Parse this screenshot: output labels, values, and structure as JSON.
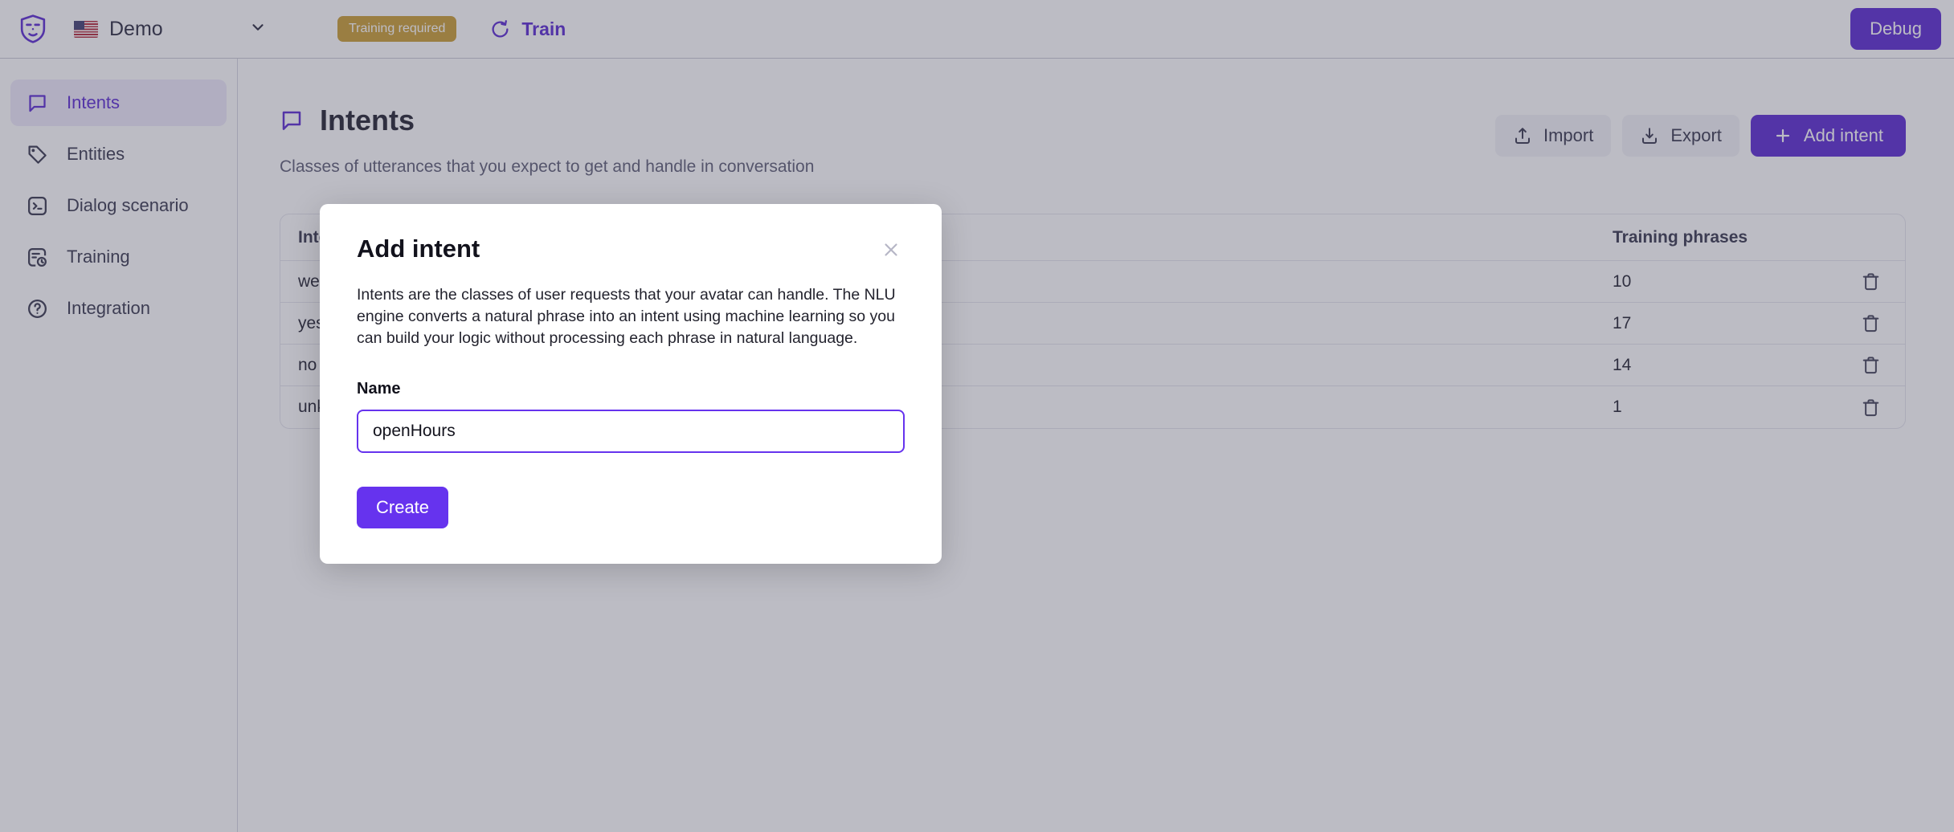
{
  "topbar": {
    "logo_icon": "shield-mask-logo",
    "bot": {
      "flag_icon": "us-flag-icon",
      "name": "Demo",
      "chevron_icon": "chevron-down-icon"
    },
    "status_badge": "Training required",
    "train_icon": "refresh-icon",
    "train_label": "Train",
    "debug_label": "Debug"
  },
  "sidebar": {
    "items": [
      {
        "label": "Intents",
        "icon": "speech-bubble-icon",
        "active": true
      },
      {
        "label": "Entities",
        "icon": "tag-icon",
        "active": false
      },
      {
        "label": "Dialog scenario",
        "icon": "terminal-icon",
        "active": false
      },
      {
        "label": "Training",
        "icon": "history-clock-icon",
        "active": false
      },
      {
        "label": "Integration",
        "icon": "question-mark-circle-icon",
        "active": false
      }
    ]
  },
  "main": {
    "title_icon": "speech-bubble-icon",
    "title": "Intents",
    "subtitle": "Classes of utterances that you expect to get and handle in conversation",
    "actions": {
      "import_icon": "upload-icon",
      "import_label": "Import",
      "export_icon": "download-icon",
      "export_label": "Export",
      "add_icon": "plus-icon",
      "add_label": "Add intent"
    },
    "table": {
      "columns": [
        "Intent",
        "Training phrases"
      ],
      "delete_icon": "trash-icon",
      "rows": [
        {
          "intent": "welcome",
          "phrases": "10"
        },
        {
          "intent": "yes",
          "phrases": "17"
        },
        {
          "intent": "no",
          "phrases": "14"
        },
        {
          "intent": "unknown",
          "phrases": "1"
        }
      ]
    }
  },
  "modal": {
    "title": "Add intent",
    "close_icon": "close-icon",
    "description": "Intents are the classes of user requests that your avatar can handle. The NLU engine converts a natural phrase into an intent using machine learning so you can build your logic without processing each phrase in natural language.",
    "field_label": "Name",
    "field_value": "openHours",
    "field_placeholder": "",
    "submit_label": "Create"
  },
  "colors": {
    "purple": "#5624d0",
    "purple_bright": "#6633ee",
    "badge_gold": "#c99b2e",
    "ink": "#33334a"
  }
}
